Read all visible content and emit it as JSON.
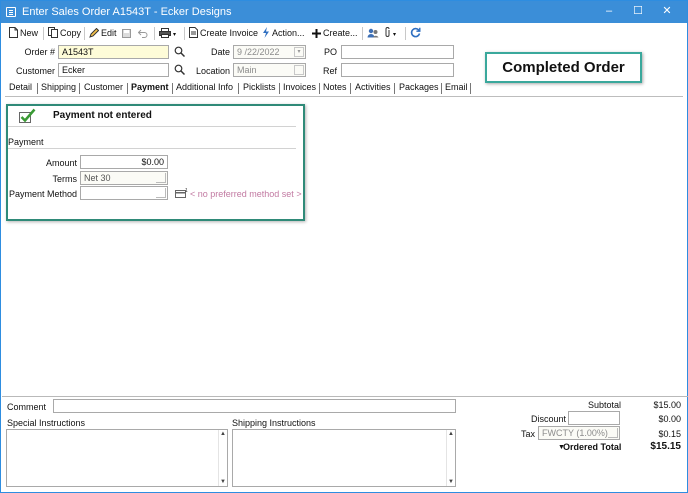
{
  "window": {
    "title": "Enter Sales Order A1543T - Ecker Designs",
    "minimize_glyph": "–",
    "maximize_glyph": "☐",
    "close_glyph": "✕"
  },
  "toolbar": {
    "new_label": "New",
    "copy_label": "Copy",
    "edit_label": "Edit",
    "create_invoice_label": "Create Invoice",
    "action_label": "Action...",
    "create_label": "Create..."
  },
  "header": {
    "order_label": "Order #",
    "order_value": "A1543T",
    "customer_label": "Customer",
    "customer_value": "Ecker",
    "date_label": "Date",
    "date_value": "9 /22/2022",
    "location_label": "Location",
    "location_value": "Main",
    "po_label": "PO",
    "po_value": "",
    "ref_label": "Ref",
    "ref_value": ""
  },
  "callout": "Completed Order",
  "tabs": [
    "Detail",
    "Shipping",
    "Customer",
    "Payment",
    "Additional Info",
    "Picklists",
    "Invoices",
    "Notes",
    "Activities",
    "Packages",
    "Email"
  ],
  "active_tab": "Payment",
  "payment": {
    "status": "Payment not entered",
    "section_label": "Payment",
    "amount_label": "Amount",
    "amount_value": "$0.00",
    "terms_label": "Terms",
    "terms_value": "Net 30",
    "method_label": "Payment Method",
    "method_value": "",
    "preferred_note": "< no preferred method set >"
  },
  "footer": {
    "comment_label": "Comment",
    "comment_value": "",
    "special_label": "Special Instructions",
    "shipping_label": "Shipping Instructions",
    "subtotal_label": "Subtotal",
    "subtotal_value": "$15.00",
    "discount_label": "Discount",
    "discount_input": "",
    "discount_value": "$0.00",
    "tax_label": "Tax",
    "tax_code": "FWCTY (1.00%)",
    "tax_value": "$0.15",
    "ordered_total_label": "Ordered Total",
    "ordered_total_value": "$15.15"
  },
  "colors": {
    "titlebar": "#3b8ed8",
    "highlight_border": "#2f8a78",
    "callout_border": "#3aa89c",
    "required_field": "#fefcd8"
  }
}
